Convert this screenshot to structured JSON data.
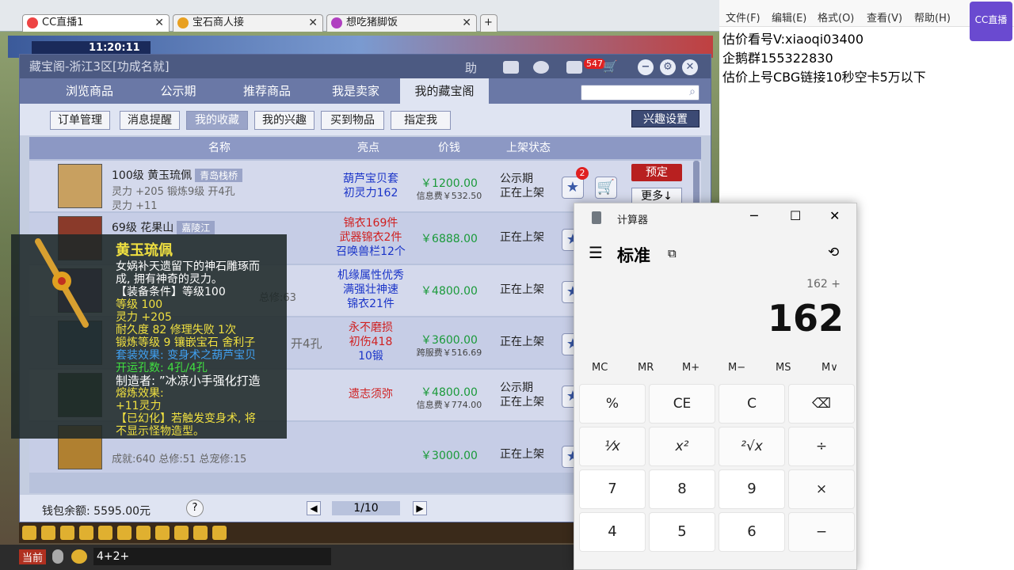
{
  "browser": {
    "tabs": [
      {
        "label": "CC直播1",
        "active": true
      },
      {
        "label": "宝石商人接",
        "active": false
      },
      {
        "label": "想吃猪脚饭",
        "active": false
      }
    ]
  },
  "game": {
    "time": "11:20:11",
    "chat_input": "4+2+",
    "chat_tab": "当前"
  },
  "cbg": {
    "title": "藏宝阁-浙江3区[功成名就]",
    "badge_count": "547",
    "title_icons": {
      "help": "助"
    },
    "nav": [
      "浏览商品",
      "公示期",
      "推荐商品",
      "我是卖家",
      "我的藏宝阁"
    ],
    "active_nav": 4,
    "subbuttons": [
      "订单管理",
      "消息提醒",
      "我的收藏",
      "我的兴趣",
      "买到物品",
      "指定我"
    ],
    "active_sub": 2,
    "interest_settings": "兴趣设置",
    "headers": {
      "name": "名称",
      "highlight": "亮点",
      "price": "价钱",
      "status": "上架状态"
    },
    "rows": [
      {
        "name": "100级 黄玉琉佩",
        "tag": "青岛栈桥",
        "attr": "灵力 +205 锻炼9级 开4孔",
        "attr2": "灵力 +11",
        "hl": [
          "葫芦宝贝套",
          "初灵力162"
        ],
        "hl_colors": [
          "#1a34c8",
          "#1a34c8"
        ],
        "price": "￥1200.00",
        "fee": "信息费￥532.50",
        "status": [
          "公示期",
          "正在上架"
        ],
        "star_count": "2",
        "action": "预定",
        "more": "更多↓"
      },
      {
        "name": "69级 花果山",
        "tag": "嘉陵江",
        "attr": "",
        "attr2": "",
        "hl": [
          "锦衣169件",
          "武器锦衣2件",
          "召唤兽栏12个"
        ],
        "hl_colors": [
          "#d02020",
          "#d02020",
          "#1a34c8"
        ],
        "price": "￥6888.00",
        "fee": "",
        "status": [
          "正在上架"
        ]
      },
      {
        "name": "",
        "tag": "",
        "attr": "总修:63",
        "attr2": "",
        "hl": [
          "机缘属性优秀",
          "满强壮神速",
          "锦衣21件"
        ],
        "hl_colors": [
          "#1a34c8",
          "#1a34c8",
          "#1a34c8"
        ],
        "price": "￥4800.00",
        "fee": "",
        "status": [
          "正在上架"
        ]
      },
      {
        "name": "",
        "tag": "",
        "attr": "开4孔",
        "attr2": "",
        "hl": [
          "永不磨损",
          "初伤418",
          "10锻"
        ],
        "hl_colors": [
          "#d02020",
          "#d02020",
          "#1a34c8"
        ],
        "price": "￥3600.00",
        "fee": "跨服费￥516.69",
        "status": [
          "正在上架"
        ]
      },
      {
        "name": "",
        "tag": "",
        "attr": "",
        "attr2": "",
        "hl": [
          "遗志须弥"
        ],
        "hl_colors": [
          "#d02020"
        ],
        "price": "￥4800.00",
        "fee": "信息费￥774.00",
        "status": [
          "公示期",
          "正在上架"
        ]
      },
      {
        "name": "",
        "tag": "",
        "attr": "成就:640 总修:51 总宠修:15",
        "attr2": "",
        "hl": [],
        "hl_colors": [],
        "price": "￥3000.00",
        "fee": "",
        "status": [
          "正在上架"
        ]
      }
    ],
    "wallet": "钱包余额: 5595.00元",
    "help_q": "?",
    "pager": "1/10"
  },
  "tooltip": {
    "title": "黄玉琉佩",
    "desc1": "女娲补天遗留下的神石雕琢而",
    "desc2": "成, 拥有神奇的灵力。",
    "req": "【装备条件】等级100",
    "level": "等级 100",
    "spirit": "灵力 +205",
    "durability": "耐久度 82  修理失败 1次",
    "forge": "锻炼等级 9  镶嵌宝石 舍利子",
    "set": "套装效果: 变身术之葫芦宝贝",
    "holes": "开运孔数: 4孔/4孔",
    "maker": "制造者: ”冰凉小手强化打造",
    "melt": "熔炼效果:",
    "melt_val": "+11灵力",
    "note1": "【已幻化】若触发变身术, 将",
    "note2": "不显示怪物造型。"
  },
  "notepad": {
    "menu": [
      "文件(F)",
      "编辑(E)",
      "格式(O)",
      "查看(V)",
      "帮助(H)"
    ],
    "lines": [
      "估价看号V:xiaoqi03400",
      "企鹅群155322830",
      "估价上号CBG链接10秒空卡5万以下"
    ],
    "watermark": "CC直播"
  },
  "calculator": {
    "title": "计算器",
    "mode": "标准",
    "expression": "162 +",
    "display": "162",
    "memory": [
      "MC",
      "MR",
      "M+",
      "M−",
      "MS",
      "M∨"
    ],
    "row1": [
      "%",
      "CE",
      "C",
      "⌫"
    ],
    "row2": [
      "¹⁄x",
      "x²",
      "²√x",
      "÷"
    ],
    "row3": [
      "7",
      "8",
      "9",
      "×"
    ],
    "row4": [
      "4",
      "5",
      "6",
      "−"
    ]
  }
}
